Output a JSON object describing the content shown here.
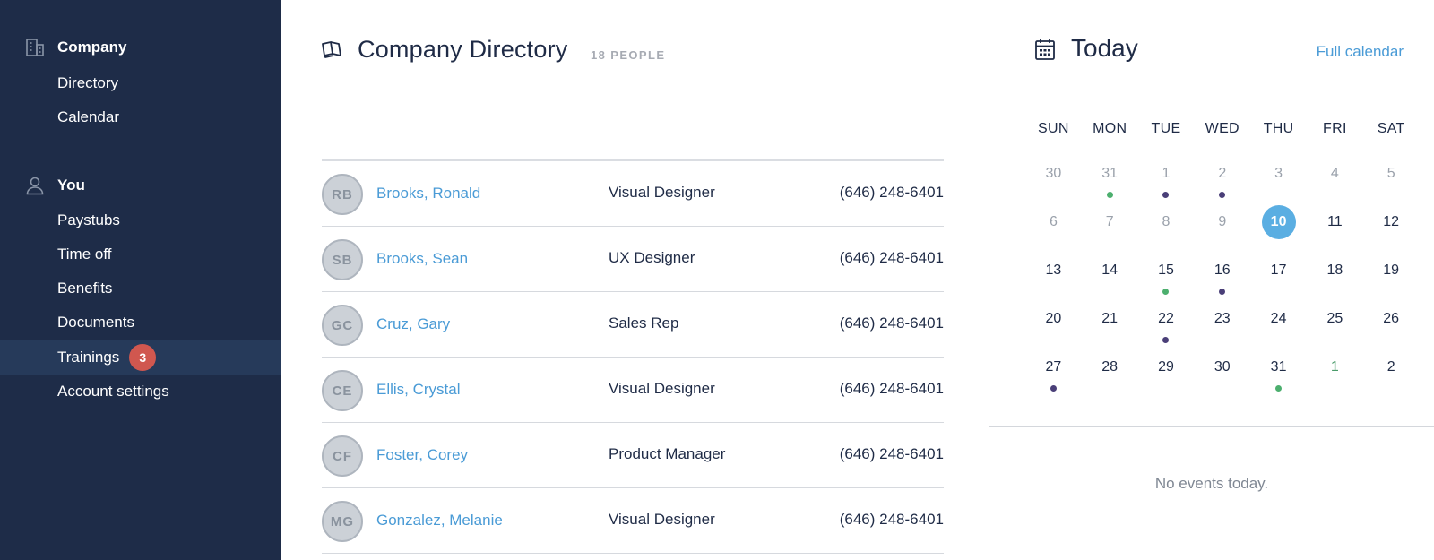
{
  "sidebar": {
    "company": {
      "title": "Company",
      "items": [
        {
          "label": "Directory"
        },
        {
          "label": "Calendar"
        }
      ]
    },
    "you": {
      "title": "You",
      "items": [
        {
          "label": "Paystubs"
        },
        {
          "label": "Time off"
        },
        {
          "label": "Benefits"
        },
        {
          "label": "Documents"
        },
        {
          "label": "Trainings",
          "badge": "3",
          "active": true
        },
        {
          "label": "Account settings"
        }
      ]
    },
    "icons": {
      "company": "building-icon",
      "you": "user-icon"
    }
  },
  "directory": {
    "title": "Company Directory",
    "count": "18 PEOPLE",
    "icon": "book-icon",
    "people": [
      {
        "initials": "RB",
        "name": "Brooks, Ronald",
        "role": "Visual Designer",
        "phone": "(646) 248-6401"
      },
      {
        "initials": "SB",
        "name": "Brooks, Sean",
        "role": "UX Designer",
        "phone": "(646) 248-6401"
      },
      {
        "initials": "GC",
        "name": "Cruz, Gary",
        "role": "Sales Rep",
        "phone": "(646) 248-6401"
      },
      {
        "initials": "CE",
        "name": "Ellis, Crystal",
        "role": "Visual Designer",
        "phone": "(646) 248-6401"
      },
      {
        "initials": "CF",
        "name": "Foster, Corey",
        "role": "Product Manager",
        "phone": "(646) 248-6401"
      },
      {
        "initials": "MG",
        "name": "Gonzalez, Melanie",
        "role": "Visual Designer",
        "phone": "(646) 248-6401"
      }
    ]
  },
  "calendar": {
    "title": "Today",
    "full_calendar_label": "Full calendar",
    "icon": "calendar-icon",
    "weekdays": [
      "SUN",
      "MON",
      "TUE",
      "WED",
      "THU",
      "FRI",
      "SAT"
    ],
    "weeks": [
      [
        {
          "d": "30",
          "state": "muted"
        },
        {
          "d": "31",
          "state": "muted",
          "dot": "green"
        },
        {
          "d": "1",
          "state": "muted",
          "dot": "purple"
        },
        {
          "d": "2",
          "state": "muted",
          "dot": "purple"
        },
        {
          "d": "3",
          "state": "muted"
        },
        {
          "d": "4",
          "state": "muted"
        },
        {
          "d": "5",
          "state": "muted"
        }
      ],
      [
        {
          "d": "6",
          "state": "muted"
        },
        {
          "d": "7",
          "state": "muted"
        },
        {
          "d": "8",
          "state": "muted"
        },
        {
          "d": "9",
          "state": "muted"
        },
        {
          "d": "10",
          "state": "today"
        },
        {
          "d": "11"
        },
        {
          "d": "12"
        }
      ],
      [
        {
          "d": "13"
        },
        {
          "d": "14"
        },
        {
          "d": "15",
          "dot": "green"
        },
        {
          "d": "16",
          "dot": "purple"
        },
        {
          "d": "17"
        },
        {
          "d": "18"
        },
        {
          "d": "19"
        }
      ],
      [
        {
          "d": "20"
        },
        {
          "d": "21"
        },
        {
          "d": "22",
          "dot": "purple"
        },
        {
          "d": "23"
        },
        {
          "d": "24"
        },
        {
          "d": "25"
        },
        {
          "d": "26"
        }
      ],
      [
        {
          "d": "27",
          "dot": "purple"
        },
        {
          "d": "28"
        },
        {
          "d": "29"
        },
        {
          "d": "30"
        },
        {
          "d": "31",
          "dot": "green"
        },
        {
          "d": "1",
          "state": "next"
        },
        {
          "d": "2"
        }
      ]
    ],
    "dot_colors": {
      "green": "#4caf6e",
      "purple": "#4a3f78"
    },
    "no_events": "No events today."
  },
  "colors": {
    "sidebar_bg": "#1e2c48",
    "link": "#4a9bd6",
    "badge": "#d0574f",
    "today": "#5aaee2"
  }
}
